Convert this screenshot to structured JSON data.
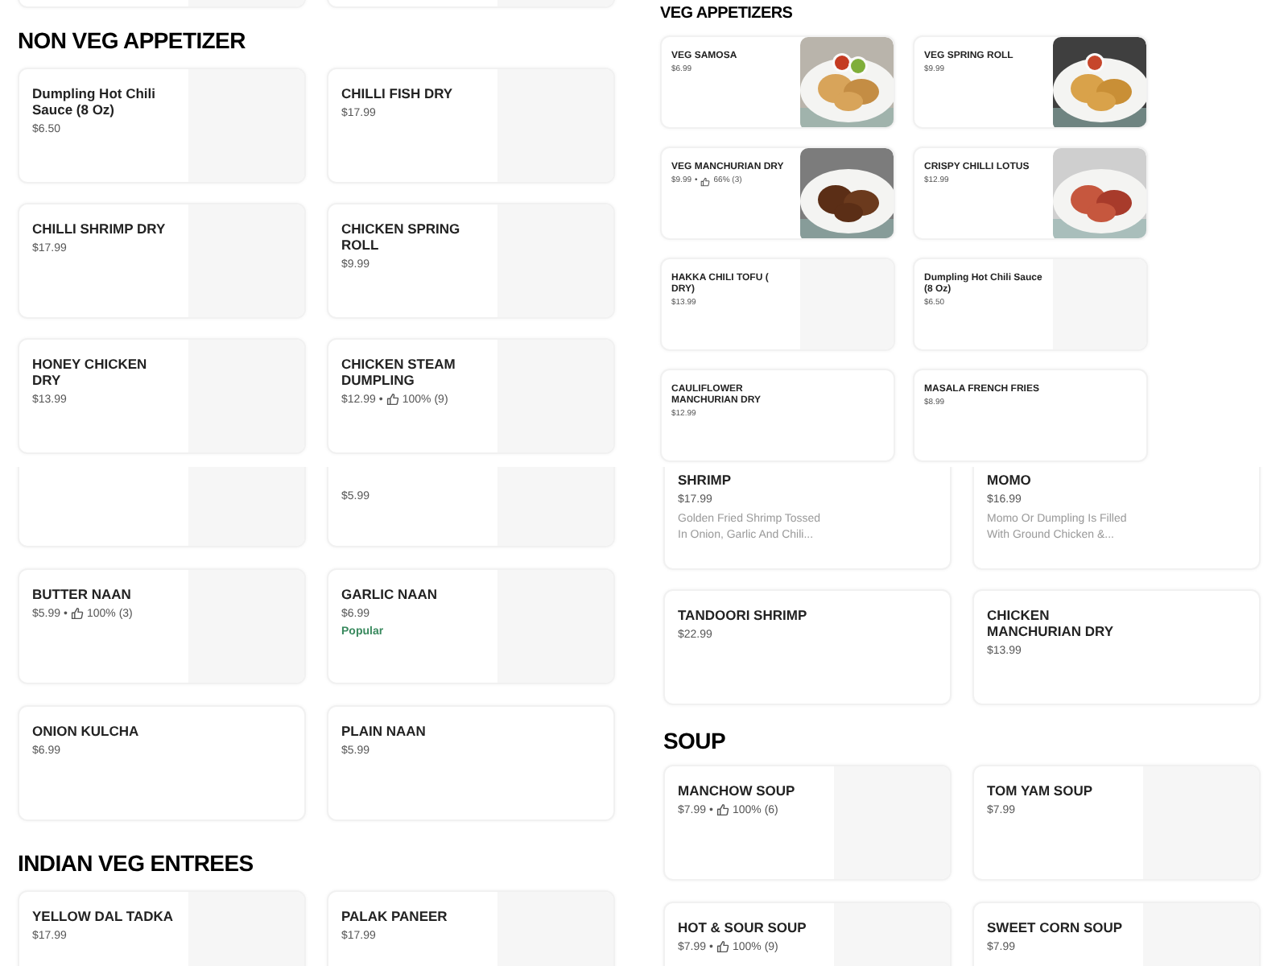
{
  "panels": [
    {
      "sections": [
        {
          "items": [
            {
              "kind": "placeholder"
            },
            {
              "kind": "placeholder"
            }
          ]
        },
        {
          "heading": "NON VEG APPETIZER",
          "items": [
            {
              "name": "Dumpling Hot Chili Sauce (8 Oz)",
              "price": "$6.50",
              "kind": "placeholder"
            },
            {
              "name": "CHILLI FISH DRY",
              "price": "$17.99",
              "kind": "placeholder"
            },
            {
              "name": "CHILLI SHRIMP DRY",
              "price": "$17.99",
              "kind": "placeholder"
            },
            {
              "name": "CHICKEN SPRING ROLL",
              "price": "$9.99",
              "kind": "placeholder"
            },
            {
              "name": "HONEY CHICKEN DRY",
              "price": "$13.99",
              "kind": "placeholder"
            },
            {
              "name": "CHICKEN STEAM DUMPLING",
              "price": "$12.99",
              "separator": "•",
              "rating": "100% (9)",
              "kind": "placeholder"
            }
          ]
        }
      ]
    },
    {
      "sections": [
        {
          "items": [
            {
              "kind": "placeholder"
            },
            {
              "price": "$5.99",
              "kind": "placeholder"
            },
            {
              "name": "BUTTER NAAN",
              "price": "$5.99",
              "separator": "•",
              "rating": "100% (3)",
              "kind": "placeholder"
            },
            {
              "name": "GARLIC NAAN",
              "price": "$6.99",
              "badge": "Popular",
              "kind": "placeholder"
            },
            {
              "name": "ONION KULCHA",
              "price": "$6.99",
              "kind": "plain"
            },
            {
              "name": "PLAIN NAAN",
              "price": "$5.99",
              "kind": "plain"
            }
          ]
        },
        {
          "heading": "INDIAN VEG ENTREES",
          "items": [
            {
              "name": "YELLOW DAL TADKA",
              "price": "$17.99",
              "kind": "placeholder"
            },
            {
              "name": "PALAK PANEER",
              "price": "$17.99",
              "kind": "placeholder"
            }
          ]
        }
      ]
    },
    {
      "sections": [
        {
          "heading": "VEG APPETIZERS",
          "items": [
            {
              "name": "VEG SAMOSA",
              "price": "$6.99"
            },
            {
              "name": "VEG SPRING ROLL",
              "price": "$9.99"
            },
            {
              "name": "VEG MANCHURIAN DRY",
              "price": "$9.99",
              "separator": "•",
              "rating": "66% (3)"
            },
            {
              "name": "CRISPY CHILLI LOTUS",
              "price": "$12.99"
            },
            {
              "name": "HAKKA CHILI TOFU ( DRY)",
              "price": "$13.99",
              "kind": "placeholder"
            },
            {
              "name": "Dumpling Hot Chili Sauce (8 Oz)",
              "price": "$6.50",
              "kind": "placeholder"
            },
            {
              "name": "CAULIFLOWER MANCHURIAN DRY",
              "price": "$12.99",
              "kind": "plain"
            },
            {
              "name": "MASALA FRENCH FRIES",
              "price": "$8.99",
              "kind": "plain"
            }
          ]
        }
      ]
    },
    {
      "sections": [
        {
          "items": [
            {
              "name": "SHRIMP",
              "price": "$17.99",
              "description": "Golden Fried Shrimp Tossed In Onion, Garlic And Chili...",
              "kind": "plain"
            },
            {
              "name": "MOMO",
              "price": "$16.99",
              "description": "Momo Or Dumpling Is Filled With Ground Chicken &...",
              "kind": "plain"
            },
            {
              "name": "TANDOORI SHRIMP",
              "price": "$22.99",
              "kind": "plain"
            },
            {
              "name": "CHICKEN MANCHURIAN DRY",
              "price": "$13.99",
              "kind": "plain"
            }
          ]
        }
      ]
    },
    {
      "sections": [
        {
          "heading": "SOUP",
          "items": [
            {
              "name": "MANCHOW SOUP",
              "price": "$7.99",
              "separator": "•",
              "rating": "100% (6)",
              "kind": "placeholder"
            },
            {
              "name": "TOM YAM SOUP",
              "price": "$7.99",
              "kind": "placeholder"
            },
            {
              "name": "HOT & SOUR SOUP",
              "price": "$7.99",
              "separator": "•",
              "rating": "100% (9)",
              "kind": "placeholder"
            },
            {
              "name": "SWEET CORN SOUP",
              "price": "$7.99",
              "kind": "placeholder"
            }
          ]
        }
      ]
    }
  ]
}
